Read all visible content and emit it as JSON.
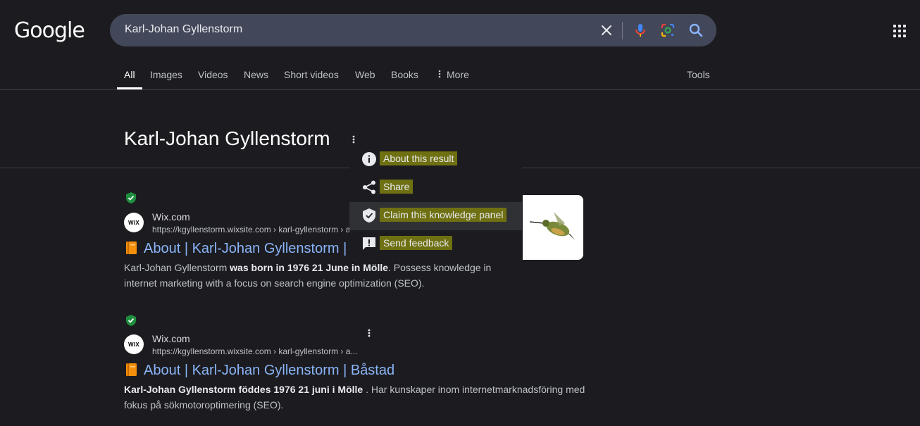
{
  "header": {
    "logo_text": "Google",
    "search_query": "Karl-Johan Gyllenstorm"
  },
  "tabs": [
    {
      "label": "All",
      "active": true
    },
    {
      "label": "Images"
    },
    {
      "label": "Videos"
    },
    {
      "label": "News"
    },
    {
      "label": "Short videos"
    },
    {
      "label": "Web"
    },
    {
      "label": "Books"
    },
    {
      "label": "More"
    }
  ],
  "tools_label": "Tools",
  "entity": {
    "title": "Karl-Johan Gyllenstorm"
  },
  "menu": {
    "items": [
      {
        "label": "About this result",
        "icon": "info-icon"
      },
      {
        "label": "Share",
        "icon": "share-icon"
      },
      {
        "label": "Claim this knowledge panel",
        "icon": "verified-shield-icon",
        "hovered": true
      },
      {
        "label": "Send feedback",
        "icon": "feedback-icon"
      }
    ],
    "highlight_color": "#6e7012"
  },
  "results": [
    {
      "site_name": "Wix.com",
      "favicon_text": "WIX",
      "url": "https://kgyllenstorm.wixsite.com › karl-gyllenstorm › a",
      "title": "About | Karl-Johan Gyllenstorm |",
      "snippet_pre": "Karl-Johan Gyllenstorm ",
      "snippet_bold": "was born in 1976 21 June in Mölle",
      "snippet_post": ". Possess knowledge in internet marketing with a focus on search engine optimization (SEO)."
    },
    {
      "site_name": "Wix.com",
      "favicon_text": "WIX",
      "url": "https://kgyllenstorm.wixsite.com › karl-gyllenstorm › a...",
      "title": "About | Karl-Johan Gyllenstorm | Båstad",
      "snippet_bold": "Karl-Johan Gyllenstorm föddes 1976 21 juni i Mölle",
      "snippet_post": " . Har kunskaper inom internetmarknadsföring med fokus på sökmotoroptimering (SEO)."
    }
  ],
  "colors": {
    "background": "#1c1c20",
    "link": "#8ab4f8",
    "verified_green": "#1e8e3e"
  }
}
